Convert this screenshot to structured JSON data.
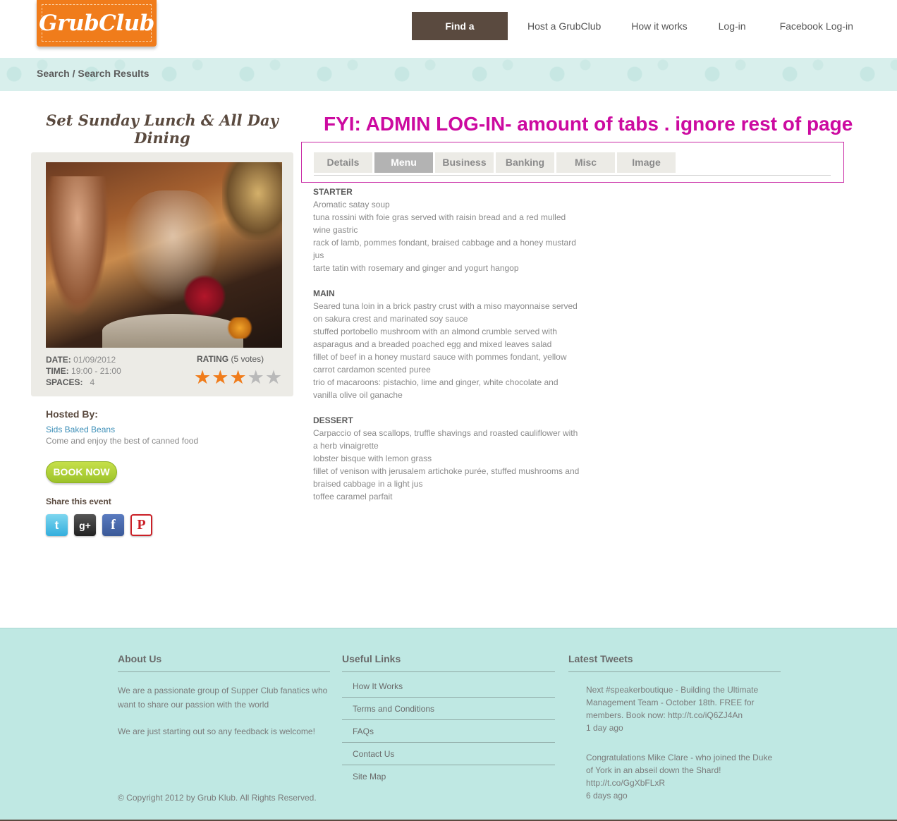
{
  "logo": {
    "text": "GrubClub"
  },
  "nav": {
    "find": "Find a GrubClub",
    "host": "Host a GrubClub",
    "how": "How it works",
    "login": "Log-in",
    "facebook": "Facebook Log-in"
  },
  "breadcrumb": "Search / Search Results",
  "event": {
    "title": "Set Sunday Lunch & All Day Dining",
    "date_label": "DATE:",
    "date": "01/09/2012",
    "time_label": "TIME:",
    "time": "19:00 - 21:00",
    "spaces_label": "SPACES:",
    "spaces": "4",
    "rating_label": "RATING",
    "rating_votes": "(5 votes)",
    "rating_value": 3,
    "rating_max": 5
  },
  "host": {
    "heading": "Hosted By:",
    "name": "Sids Baked Beans",
    "description": "Come and enjoy the  best of canned food"
  },
  "book_label": "BOOK NOW",
  "share_label": "Share this event",
  "social_icons": [
    "twitter-icon",
    "google-plus-icon",
    "facebook-icon",
    "pinterest-icon"
  ],
  "annotation": "FYI: ADMIN LOG-IN- amount of tabs . ignore rest of page",
  "tabs": [
    {
      "label": "Details",
      "active": false
    },
    {
      "label": "Menu",
      "active": true
    },
    {
      "label": "Business",
      "active": false
    },
    {
      "label": "Banking",
      "active": false
    },
    {
      "label": "Misc",
      "active": false
    },
    {
      "label": "Image",
      "active": false
    }
  ],
  "menu": {
    "starter": {
      "heading": "STARTER",
      "items": [
        "Aromatic satay soup",
        "tuna rossini with foie gras served with raisin bread and a red mulled wine gastric",
        "rack of lamb, pommes fondant, braised cabbage and a honey mustard jus",
        "tarte tatin with rosemary and ginger and yogurt hangop"
      ]
    },
    "main": {
      "heading": "MAIN",
      "items": [
        "Seared tuna loin in a brick pastry crust with a miso mayonnaise served on sakura crest and marinated soy sauce",
        "stuffed portobello mushroom with an almond crumble served with asparagus and a breaded poached egg and mixed leaves salad",
        "fillet of beef in a honey mustard sauce with pommes fondant, yellow carrot cardamon scented puree",
        "trio of macaroons: pistachio, lime and ginger, white chocolate and vanilla olive oil ganache"
      ]
    },
    "dessert": {
      "heading": "DESSERT",
      "items": [
        "Carpaccio of sea scallops, truffle shavings and roasted cauliflower with a herb vinaigrette",
        "lobster bisque with lemon grass",
        "fillet of venison with jerusalem artichoke purée, stuffed mushrooms and braised cabbage in a light jus",
        "toffee caramel parfait"
      ]
    }
  },
  "footer": {
    "about": {
      "heading": "About Us",
      "p1": "We are a passionate group of Supper Club fanatics who want to share our passion with the world",
      "p2": "We are just starting out so any feedback is welcome!"
    },
    "links": {
      "heading": "Useful Links",
      "items": [
        "How It Works",
        "Terms and Conditions",
        "FAQs",
        "Contact Us",
        "Site Map"
      ]
    },
    "tweets": {
      "heading": "Latest Tweets",
      "items": [
        {
          "text": "Next #speakerboutique - Building the Ultimate Management Team - October 18th. FREE for members. Book now: http://t.co/iQ6ZJ4An",
          "time": "1 day ago"
        },
        {
          "text": "Congratulations Mike Clare - who joined the Duke of York in an abseil down the Shard! http://t.co/GgXbFLxR",
          "time": "6 days ago"
        }
      ]
    },
    "copyright": "© Copyright 2012 by Grub Klub. All Rights Reserved."
  }
}
